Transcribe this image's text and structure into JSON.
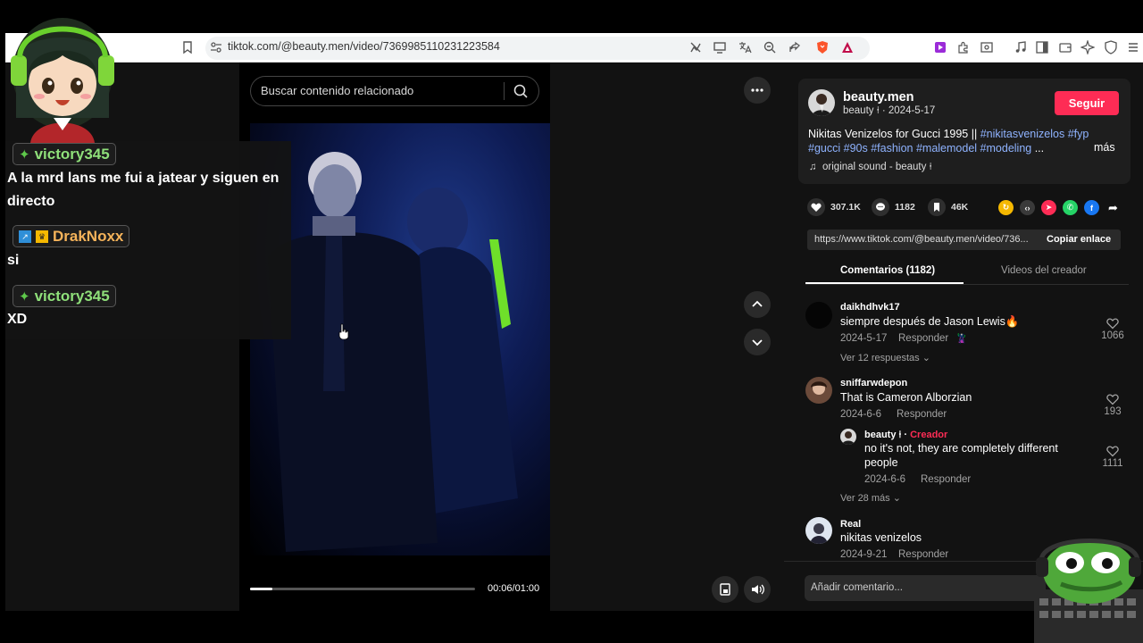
{
  "browser": {
    "url": "tiktok.com/@beauty.men/video/7369985110231223584"
  },
  "video": {
    "search_placeholder": "Buscar contenido relacionado",
    "time": "00:06/01:00",
    "progress": 0.1
  },
  "post": {
    "username": "beauty.men",
    "subline": "beauty ⍿ · 2024-5-17",
    "follow_label": "Seguir",
    "description_plain_1": "Nikitas Venizelos for Gucci 1995 || ",
    "tag_1": "#nikitasvenizelos",
    "tag_2": "#fyp",
    "tag_3": "#gucci",
    "tag_4": "#90s",
    "tag_5": "#fashion",
    "tag_6": "#malemodel",
    "tag_7": "#modeling",
    "ellipsis": " ...",
    "more_label": "más",
    "sound": "original sound - beauty ⍿",
    "likes": "307.1K",
    "comments": "1182",
    "saves": "46K",
    "link": "https://www.tiktok.com/@beauty.men/video/736...",
    "copy_label": "Copiar enlace"
  },
  "tabs": {
    "comments": "Comentarios (1182)",
    "creator_videos": "Videos del creador"
  },
  "comments": [
    {
      "user": "daikhdhvk17",
      "text": "siempre después de Jason Lewis🔥",
      "date": "2024-5-17",
      "reply": "Responder",
      "likes": "1066",
      "more": "Ver 12 respuestas"
    },
    {
      "user": "sniffarwdepon",
      "text": "That is Cameron Alborzian",
      "date": "2024-6-6",
      "reply": "Responder",
      "likes": "193",
      "more": "Ver 28 más"
    },
    {
      "user": "Real",
      "text": "nikitas venizelos",
      "date": "2024-9-21",
      "reply": "Responder"
    }
  ],
  "creator_reply": {
    "user": "beauty ⍿ · ",
    "creator_tag": "Creador",
    "text_1": "no it's not, they are completely different",
    "text_2": "people",
    "date": "2024-6-6",
    "reply": "Responder",
    "likes": "1111"
  },
  "add_comment_placeholder": "Añadir comentario...",
  "chat": [
    {
      "name": "victory345",
      "color": "#8fe07a",
      "message": "A la mrd lans me fui a jatear y siguen en",
      "message_2": "directo"
    },
    {
      "name": "DrakNoxx",
      "color": "#f5b35a",
      "message": "si"
    },
    {
      "name": "victory345",
      "color": "#8fe07a",
      "message": "XD"
    }
  ],
  "colors": {
    "accent": "#fe2c55",
    "hashtag": "#8fb3ff",
    "sidebar_bg": "#121212"
  }
}
